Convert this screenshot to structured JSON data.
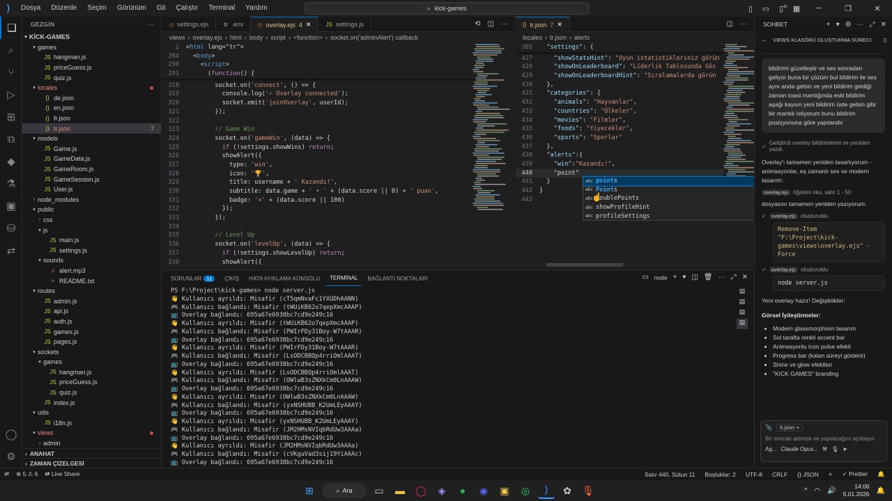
{
  "titlebar": {
    "menu": [
      "Dosya",
      "Düzenle",
      "Seçim",
      "Görünüm",
      "Git",
      "Çalıştır",
      "Terminal",
      "Yardım"
    ],
    "search": "kick-games"
  },
  "sidebar": {
    "title": "GEZGİN",
    "root": "KİCK-GAMES",
    "items": [
      {
        "label": "games",
        "depth": 1,
        "type": "folder-open"
      },
      {
        "label": "hangman.js",
        "depth": 2,
        "type": "js"
      },
      {
        "label": "priceGuess.js",
        "depth": 2,
        "type": "js"
      },
      {
        "label": "quiz.js",
        "depth": 2,
        "type": "js"
      },
      {
        "label": "locales",
        "depth": 1,
        "type": "folder-open",
        "state": "error-dot"
      },
      {
        "label": "de.json",
        "depth": 2,
        "type": "json"
      },
      {
        "label": "en.json",
        "depth": 2,
        "type": "json"
      },
      {
        "label": "fr.json",
        "depth": 2,
        "type": "json"
      },
      {
        "label": "tr.json",
        "depth": 2,
        "type": "json",
        "state": "selected",
        "badge": "7"
      },
      {
        "label": "models",
        "depth": 1,
        "type": "folder-open"
      },
      {
        "label": "Game.js",
        "depth": 2,
        "type": "js"
      },
      {
        "label": "GameData.js",
        "depth": 2,
        "type": "js"
      },
      {
        "label": "GameRoom.js",
        "depth": 2,
        "type": "js"
      },
      {
        "label": "GameSession.js",
        "depth": 2,
        "type": "js"
      },
      {
        "label": "User.js",
        "depth": 2,
        "type": "js"
      },
      {
        "label": "node_modules",
        "depth": 1,
        "type": "folder"
      },
      {
        "label": "public",
        "depth": 1,
        "type": "folder-open"
      },
      {
        "label": "css",
        "depth": 2,
        "type": "folder"
      },
      {
        "label": "js",
        "depth": 2,
        "type": "folder-open"
      },
      {
        "label": "main.js",
        "depth": 3,
        "type": "js"
      },
      {
        "label": "settings.js",
        "depth": 3,
        "type": "js"
      },
      {
        "label": "sounds",
        "depth": 2,
        "type": "folder-open"
      },
      {
        "label": "alert.mp3",
        "depth": 3,
        "type": "audio"
      },
      {
        "label": "README.txt",
        "depth": 3,
        "type": "txt"
      },
      {
        "label": "routes",
        "depth": 1,
        "type": "folder-open"
      },
      {
        "label": "admin.js",
        "depth": 2,
        "type": "js"
      },
      {
        "label": "api.js",
        "depth": 2,
        "type": "js"
      },
      {
        "label": "auth.js",
        "depth": 2,
        "type": "js"
      },
      {
        "label": "games.js",
        "depth": 2,
        "type": "js"
      },
      {
        "label": "pages.js",
        "depth": 2,
        "type": "js"
      },
      {
        "label": "sockets",
        "depth": 1,
        "type": "folder-open"
      },
      {
        "label": "games",
        "depth": 2,
        "type": "folder-open"
      },
      {
        "label": "hangman.js",
        "depth": 3,
        "type": "js"
      },
      {
        "label": "priceGuess.js",
        "depth": 3,
        "type": "js"
      },
      {
        "label": "quiz.js",
        "depth": 3,
        "type": "js"
      },
      {
        "label": "index.js",
        "depth": 2,
        "type": "js"
      },
      {
        "label": "utils",
        "depth": 1,
        "type": "folder-open"
      },
      {
        "label": "i18n.js",
        "depth": 2,
        "type": "js"
      },
      {
        "label": "views",
        "depth": 1,
        "type": "folder-open",
        "state": "error-dot"
      },
      {
        "label": "admin",
        "depth": 2,
        "type": "folder"
      }
    ],
    "outline": "ANAHAT",
    "timeline": "ZAMAN ÇİZELGESİ"
  },
  "editor_left": {
    "tabs": [
      {
        "label": "settings.ejs",
        "icon": "ejs-icon",
        "active": false
      },
      {
        "label": ".env",
        "icon": "gear-icon",
        "active": false
      },
      {
        "label": "overlay.ejs",
        "icon": "ejs-icon",
        "active": true,
        "badge": "4",
        "modified": true
      },
      {
        "label": "settings.js",
        "icon": "js-icon",
        "active": false
      }
    ],
    "breadcrumb": [
      "views",
      "overlay.ejs",
      "html",
      "body",
      "script",
      "<function>",
      "socket.on('adminAlert') callback"
    ],
    "sticky": [
      {
        "n": "2",
        "code": "<html lang=\"tr\">"
      },
      {
        "n": "284",
        "code": "  <body>"
      },
      {
        "n": "290",
        "code": "    <script>"
      },
      {
        "n": "291",
        "code": "      (function() {"
      }
    ],
    "lines": [
      {
        "n": "318",
        "code": "        socket.on('connect', () => {"
      },
      {
        "n": "319",
        "code": "          console.log('✓ Overlay connected');"
      },
      {
        "n": "320",
        "code": "          socket.emit('joinOverlay', userId);"
      },
      {
        "n": "321",
        "code": "        });"
      },
      {
        "n": "322",
        "code": ""
      },
      {
        "n": "323",
        "code": "        // Game Win"
      },
      {
        "n": "324",
        "code": "        socket.on('gameWin', (data) => {"
      },
      {
        "n": "325",
        "code": "          if (!settings.showWins) return;"
      },
      {
        "n": "326",
        "code": "          showAlert({"
      },
      {
        "n": "327",
        "code": "            type: 'win',"
      },
      {
        "n": "328",
        "code": "            icon: '🏆',"
      },
      {
        "n": "329",
        "code": "            title: username + ' Kazandı!',"
      },
      {
        "n": "330",
        "code": "            subtitle: data.game + ' • ' + (data.score || 0) + ' puan',"
      },
      {
        "n": "331",
        "code": "            badge: '+' + (data.score || 100)"
      },
      {
        "n": "332",
        "code": "          });"
      },
      {
        "n": "333",
        "code": "        });"
      },
      {
        "n": "334",
        "code": ""
      },
      {
        "n": "335",
        "code": "        // Level Up"
      },
      {
        "n": "336",
        "code": "        socket.on('levelUp', (data) => {"
      },
      {
        "n": "337",
        "code": "          if (!settings.showLevelUp) return;"
      },
      {
        "n": "338",
        "code": "          showAlert({"
      }
    ]
  },
  "editor_right": {
    "tabs": [
      {
        "label": "tr.json",
        "icon": "json-icon",
        "active": true,
        "badge": "7",
        "modified": true
      }
    ],
    "breadcrumb": [
      "locales",
      "tr.json",
      "alerts"
    ],
    "sticky": [
      {
        "n": "385",
        "code": "  \"settings\": {"
      }
    ],
    "lines": [
      {
        "n": "427",
        "code": "    \"showStatsHint\": \"Oyun istatistikleriniz görün"
      },
      {
        "n": "428",
        "code": "    \"showOnLeaderboard\": \"Liderlik Tablosunda Gös"
      },
      {
        "n": "429",
        "code": "    \"showOnLeaderboardHint\": \"Sıralamalarda görün"
      },
      {
        "n": "430",
        "code": "  },"
      },
      {
        "n": "431",
        "code": "  \"categories\": {"
      },
      {
        "n": "432",
        "code": "    \"animals\": \"Hayvanlar\","
      },
      {
        "n": "433",
        "code": "    \"countries\": \"Ülkeler\","
      },
      {
        "n": "434",
        "code": "    \"movies\": \"Filmler\","
      },
      {
        "n": "435",
        "code": "    \"foods\": \"Yiyecekler\","
      },
      {
        "n": "436",
        "code": "    \"sports\": \"Sporlar\""
      },
      {
        "n": "437",
        "code": "  },"
      },
      {
        "n": "438",
        "code": "  \"alerts\":{"
      },
      {
        "n": "439",
        "code": "    \"win\":\"Kazandı!\","
      },
      {
        "n": "440",
        "code": "    \"point\""
      },
      {
        "n": "441",
        "code": "  }"
      },
      {
        "n": "442",
        "code": "}"
      },
      {
        "n": "443",
        "code": ""
      }
    ],
    "current_line": "440"
  },
  "suggest": {
    "items": [
      {
        "label": "points",
        "match": "point",
        "selected": true
      },
      {
        "label": "Points",
        "match": "Point",
        "selected": false
      },
      {
        "label": "doublePoints",
        "match": "",
        "selected": false
      },
      {
        "label": "showProfileHint",
        "match": "",
        "selected": false
      },
      {
        "label": "profileSettings",
        "match": "",
        "selected": false
      }
    ]
  },
  "panel": {
    "tabs": [
      {
        "label": "SORUNLAR",
        "count": "11",
        "active": false
      },
      {
        "label": "ÇIKIŞ",
        "active": false
      },
      {
        "label": "HATA AYIKLAMA KONSOLU",
        "active": false
      },
      {
        "label": "TERMİNAL",
        "active": true
      },
      {
        "label": "BAĞLANTI NOKTALARI",
        "active": false
      }
    ],
    "terminal_name": "node",
    "terminal_lines": [
      "PS F:\\Project\\kick-games> node server.js",
      "👋 Kullanıcı ayrıldı: Misafir (cT5qmNvaFc1YXUDhAANN)",
      "🎮 Kullanıcı bağlandı: Misafir (tWUiKB62o7qepXmcAAAP)",
      "📺 Overlay bağlandı: 695a67e6938bc7cd9e249c16",
      "👋 Kullanıcı ayrıldı: Misafir (tWUiKB62o7qepXmcAAAP)",
      "🎮 Kullanıcı bağlandı: Misafir (PWIrFDy31Boy-W7tAAAR)",
      "📺 Overlay bağlandı: 695a67e6938bc7cd9e249c16",
      "👋 Kullanıcı ayrıldı: Misafir (PWIrFDy31Boy-W7tAAAR)",
      "🎮 Kullanıcı bağlandı: Misafir (LsODCBBQp4rriOmlAAAT)",
      "📺 Overlay bağlandı: 695a67e6938bc7cd9e249c16",
      "👋 Kullanıcı ayrıldı: Misafir (LsODCBBQp4rriOmlAAAT)",
      "🎮 Kullanıcı bağlandı: Misafir (OWlwB3sZNXkCm0LnAAAW)",
      "📺 Overlay bağlandı: 695a67e6938bc7cd9e249c16",
      "👋 Kullanıcı ayrıldı: Misafir (OWlwB3sZNXkCm0LnAAAW)",
      "🎮 Kullanıcı bağlandı: Misafir (yxNSHUBB_K2UmLEyAAAY)",
      "📺 Overlay bağlandı: 695a67e6938bc7cd9e249c16",
      "👋 Kullanıcı ayrıldı: Misafir (yxNSHUBB_K2UmLEyAAAY)",
      "🎮 Kullanıcı bağlandı: Misafir (JM2HMsNVIqbRdUw3AAAa)",
      "📺 Overlay bağlandı: 695a67e6938bc7cd9e249c16",
      "👋 Kullanıcı ayrıldı: Misafir (JM2HMsNVIqbRdUw3AAAa)",
      "🎮 Kullanıcı bağlandı: Misafir (cVKguVad3sij19YiAAAc)",
      "📺 Overlay bağlandı: 695a67e6938bc7cd9e249c16"
    ]
  },
  "chat": {
    "title": "SOHBET",
    "session_title": "VIEWS KLASÖRÜ OLUŞTURMA SÜRECİ",
    "user_message": "bildirimi güzelleştir ve ses sonradan geliyor buna bir çözüm bul bildirim ile ses aynı anda gelsin ve yeni bildirim geldiği zaman toast mantığında eski bildirim aşağı kaysın yeni bildirim üste gelsin gibi bir mantık istiyorum bunu bildirim posizyonuna göre yapılandır",
    "step_done": "Geliştirdi overlay bildirimlerini ve yeniden yazdı.",
    "reply_intro": "Overlay'ı tamamen yeniden tasarlıyorum - animasyonlar, eş zamanlı ses ve modern tasarım:",
    "read_file": "overlay.ejs",
    "read_text": "öğesini oku, satır 1 - 50",
    "rewrite_text": "dosyasını tamamen yeniden yazıyorum:",
    "created_1_file": "overlay.ejs",
    "created_1_text": "oluşturuldu",
    "cmd_block": "Remove-Item \"F:\\Project\\kick-games\\views\\overlay.ejs\" -Force",
    "created_2_file": "overlay.ejs",
    "created_2_text": "oluşturuldu",
    "cmd_2": "node server.js",
    "ready_text": "Yeni overlay hazır! Değişiklikler:",
    "section_title": "Görsel İyileştirmeler:",
    "bullets": [
      "Modern glassmorphism tasarım",
      "Sol tarafta renkli accent bar",
      "Animasyonlu icon pulse efekti",
      "Progress bar (kalan süreyi gösterir)",
      "Shine ve glow efektleri",
      "\"KICK GAMES\" branding"
    ],
    "input_context": "tr.json",
    "input_placeholder": "Bir sonraki adımda ne yapılacağını açıklayın",
    "mode": "Ag...",
    "model": "Claude Opus..."
  },
  "statusbar": {
    "errors": "5",
    "warnings": "6",
    "live_share": "Live Share",
    "position": "Satır 440, Sütun 11",
    "spaces": "Boşluklar: 2",
    "encoding": "UTF-8",
    "eol": "CRLF",
    "language": "JSON",
    "prettier": "Prettier"
  },
  "taskbar": {
    "search": "Ara",
    "time": "14:06",
    "date": "5.01.2026"
  }
}
